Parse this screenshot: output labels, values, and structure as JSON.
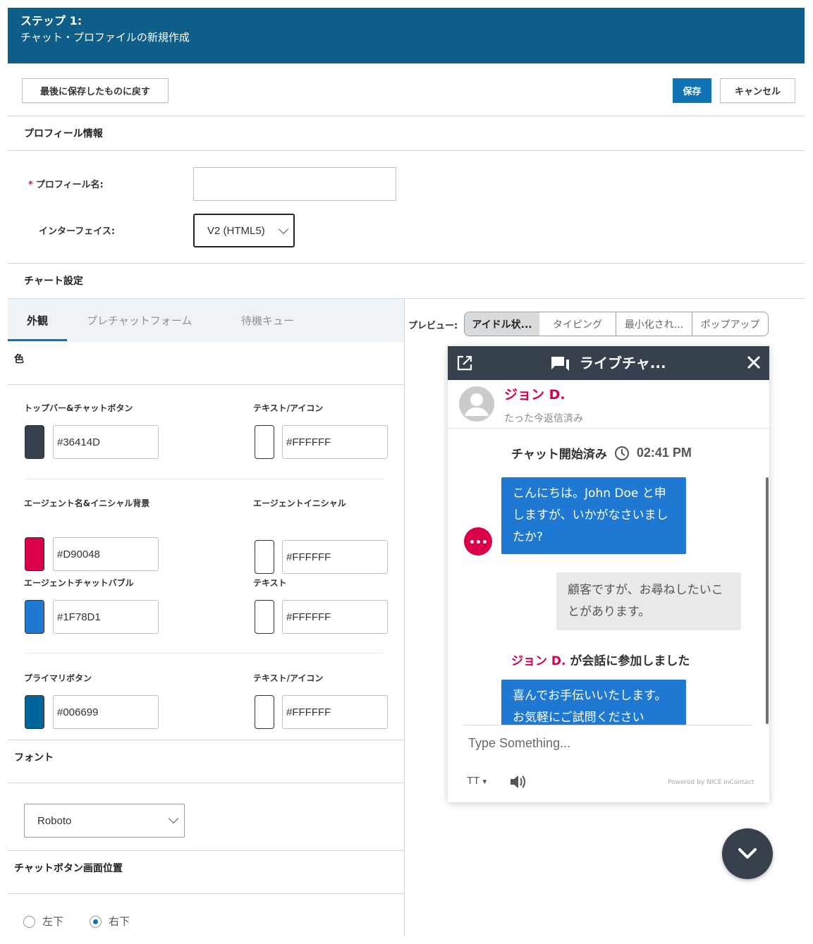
{
  "header": {
    "step": "ステップ 1:",
    "subtitle": "チャット・プロファイルの新規作成"
  },
  "toolbar": {
    "revert_label": "最後に保存したものに戻す",
    "save_label": "保存",
    "cancel_label": "キャンセル"
  },
  "profile_info": {
    "title": "プロフィール情報",
    "name_label": "プロフィール名:",
    "name_value": "",
    "interface_label": "インターフェイス:",
    "interface_value": "V2 (HTML5)"
  },
  "chat_settings": {
    "title": "チャート設定",
    "tabs": [
      {
        "label": "外観",
        "active": true
      },
      {
        "label": "プレチャットフォーム",
        "active": false
      },
      {
        "label": "待機キュー",
        "active": false
      }
    ],
    "colors_title": "色",
    "colors": [
      {
        "label": "トップバー&チャットボタン",
        "hex": "#36414D",
        "text_label": "テキスト/アイコン",
        "text_hex": "#FFFFFF"
      },
      {
        "label": "エージェント名&イニシャル背景",
        "hex": "#D90048",
        "text_label": "エージェントイニシャル",
        "text_hex": "#FFFFFF"
      },
      {
        "label": "エージェントチャットバブル",
        "hex": "#1F78D1",
        "text_label": "テキスト",
        "text_hex": "#FFFFFF"
      },
      {
        "label": "プライマリボタン",
        "hex": "#006699",
        "text_label": "テキスト/アイコン",
        "text_hex": "#FFFFFF"
      }
    ],
    "font_title": "フォント",
    "font_value": "Roboto",
    "position_title": "チャットボタン画面位置",
    "positions": [
      {
        "label": "左下",
        "selected": false
      },
      {
        "label": "右下",
        "selected": true
      }
    ]
  },
  "preview": {
    "label": "プレビュー:",
    "modes": [
      {
        "label": "アイドル状...",
        "active": true
      },
      {
        "label": "タイピング",
        "active": false
      },
      {
        "label": "最小化され...",
        "active": false
      },
      {
        "label": "ポップアップ",
        "active": false
      }
    ],
    "chat": {
      "title": "ライブチャ...",
      "agent_name": "ジョン D.",
      "agent_status": "たった今返信済み",
      "started_text": "チャット開始済み",
      "started_time": "02:41 PM",
      "agent_msg_1": "こんにちは。John Doe と申しますが、いかがなさいましたか?",
      "user_msg": "顧客ですが、お尋ねしたいことがあります。",
      "joined_name": "ジョン D.",
      "joined_text": " が会話に参加しました",
      "agent_msg_2": "喜んでお手伝いいたします。お気軽にご試問ください",
      "input_placeholder": "Type Something...",
      "powered_by": "Powered by NICE inContact",
      "text_size_icon": "TT"
    },
    "icons": {
      "popout": "popout-icon",
      "chat": "chat-bubbles-icon",
      "close": "close-icon",
      "clock": "clock-icon",
      "volume": "volume-icon",
      "fab": "chevron-down-icon"
    }
  },
  "colors": {
    "header_bg": "#0f5e89",
    "primary": "#0f73b6",
    "chat_topbar": "#36414D",
    "agent_name": "#D90048",
    "agent_bubble": "#1F78D1"
  }
}
